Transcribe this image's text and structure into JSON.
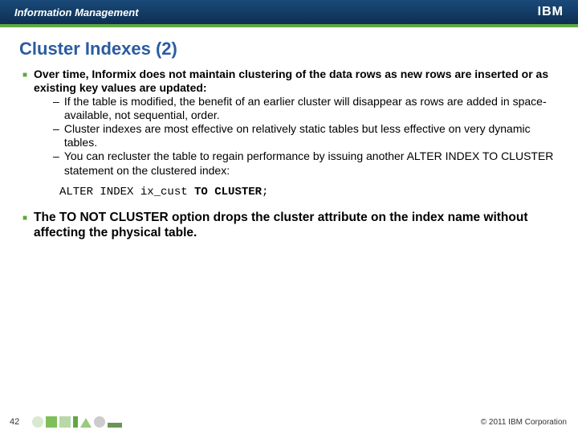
{
  "header": {
    "brand": "Information Management",
    "logo": "IBM"
  },
  "title": "Cluster Indexes (2)",
  "bullet1": {
    "lead": "Over time, Informix does not maintain clustering of the data rows as new rows are inserted or as existing key values are updated:",
    "sub1": "If the table is modified, the benefit of an earlier cluster will disappear as rows are added in space-available, not sequential, order.",
    "sub2": "Cluster indexes are most effective on relatively static tables but less effective on very dynamic tables.",
    "sub3": "You can recluster the table to regain performance by issuing another ALTER INDEX TO CLUSTER statement on the clustered index:"
  },
  "code": {
    "p1": "ALTER INDEX ix_cust ",
    "p2": "TO CLUSTER",
    "p3": ";"
  },
  "bullet2": {
    "pre": "The ",
    "kw": "TO NOT CLUSTER",
    "post": " option drops the cluster attribute on the index name without affecting the physical table."
  },
  "footer": {
    "page": "42",
    "copyright": "© 2011 IBM Corporation"
  }
}
